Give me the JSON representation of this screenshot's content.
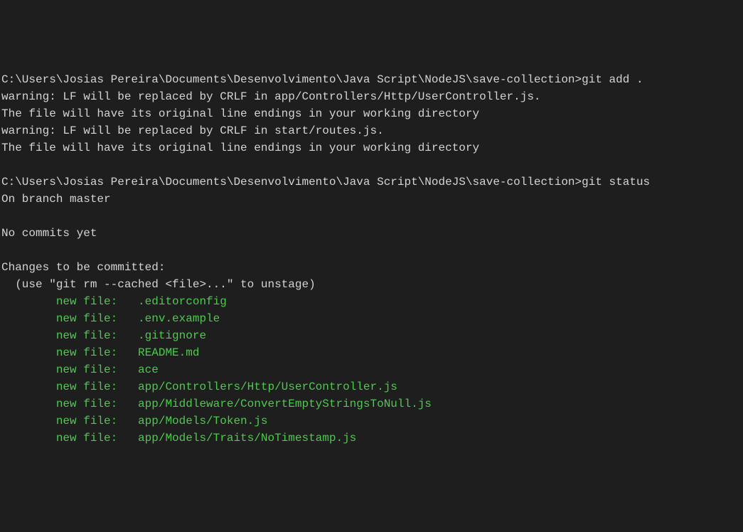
{
  "prompt1": {
    "path": "C:\\Users\\Josias Pereira\\Documents\\Desenvolvimento\\Java Script\\NodeJS\\save-collection>",
    "command": "git add ."
  },
  "output1": {
    "line1": "warning: LF will be replaced by CRLF in app/Controllers/Http/UserController.js.",
    "line2": "The file will have its original line endings in your working directory",
    "line3": "warning: LF will be replaced by CRLF in start/routes.js.",
    "line4": "The file will have its original line endings in your working directory"
  },
  "prompt2": {
    "path": "C:\\Users\\Josias Pereira\\Documents\\Desenvolvimento\\Java Script\\NodeJS\\save-collection>",
    "command": "git status"
  },
  "output2": {
    "branch": "On branch master",
    "commits": "No commits yet",
    "changes_header": "Changes to be committed:",
    "unstage_hint": "  (use \"git rm --cached <file>...\" to unstage)"
  },
  "staged_files": {
    "f0": "        new file:   .editorconfig",
    "f1": "        new file:   .env.example",
    "f2": "        new file:   .gitignore",
    "f3": "        new file:   README.md",
    "f4": "        new file:   ace",
    "f5": "        new file:   app/Controllers/Http/UserController.js",
    "f6": "        new file:   app/Middleware/ConvertEmptyStringsToNull.js",
    "f7": "        new file:   app/Models/Token.js",
    "f8": "        new file:   app/Models/Traits/NoTimestamp.js"
  }
}
